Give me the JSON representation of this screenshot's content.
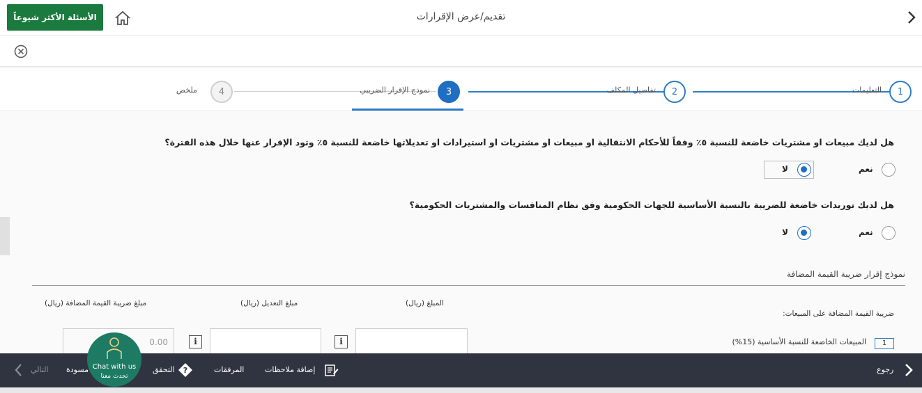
{
  "header": {
    "faq_label": "الأسئلة الأكثر شيوعاً",
    "title": "تقديم/عرض الإقرارات",
    "home_icon": "home-icon",
    "back_icon": "chevron-right-icon",
    "brand_color": "#1b7a3e"
  },
  "subbar": {
    "close_icon": "close-circle-icon"
  },
  "stepper": {
    "steps": [
      {
        "num": "1",
        "label": "التعليمات",
        "state": "done"
      },
      {
        "num": "2",
        "label": "تفاصيل المكلف",
        "state": "done"
      },
      {
        "num": "3",
        "label": "نموذج الإقرار الضريبي",
        "state": "active"
      },
      {
        "num": "4",
        "label": "ملخص",
        "state": "pending"
      }
    ],
    "accent_color": "#1e6fc2"
  },
  "questions": [
    {
      "text": "هل لديك مبيعات او مشتريات خاضعة للنسبة ٥٪ وفقاً للأحكام الانتقالية او مبيعات او مشتريات او استيرادات او تعديلاتها خاضعة للنسبة ٥٪ وتود الإقرار عنها خلال هذه الفترة؟",
      "yes_label": "نعم",
      "no_label": "لا",
      "selected": "no"
    },
    {
      "text": "هل لديك توريدات خاضعة للضريبة بالنسبة الأساسية للجهات الحكومية وفق نظام المنافسات والمشتريات الحكومية؟",
      "yes_label": "نعم",
      "no_label": "لا",
      "selected": "no"
    }
  ],
  "form": {
    "section_title": "نموذج إقرار ضريبة القيمة المضافة",
    "columns": {
      "amount": "المبلغ (ريال)",
      "adjustment": "مبلغ التعديل (ريال)",
      "vat_amount": "مبلغ ضريبة القيمة المضافة (ريال)"
    },
    "sales_heading": "ضريبة القيمة المضافة على المبيعات:",
    "rows": [
      {
        "num": "1",
        "label": "المبيعات الخاضعة للنسبة الأساسية (15%)",
        "amount": "",
        "adjustment": "",
        "vat": "0.00"
      }
    ],
    "info_glyph": "i"
  },
  "toolbar": {
    "back_label": "رجوع",
    "add_notes_label": "إضافة ملاحظات",
    "attachments_label": "المرفقات",
    "verify_label": "التحقق",
    "draft_label": "مسودة",
    "next_label": "التالي",
    "chat_en": "Chat with us",
    "chat_ar": "تحدث معنا"
  }
}
